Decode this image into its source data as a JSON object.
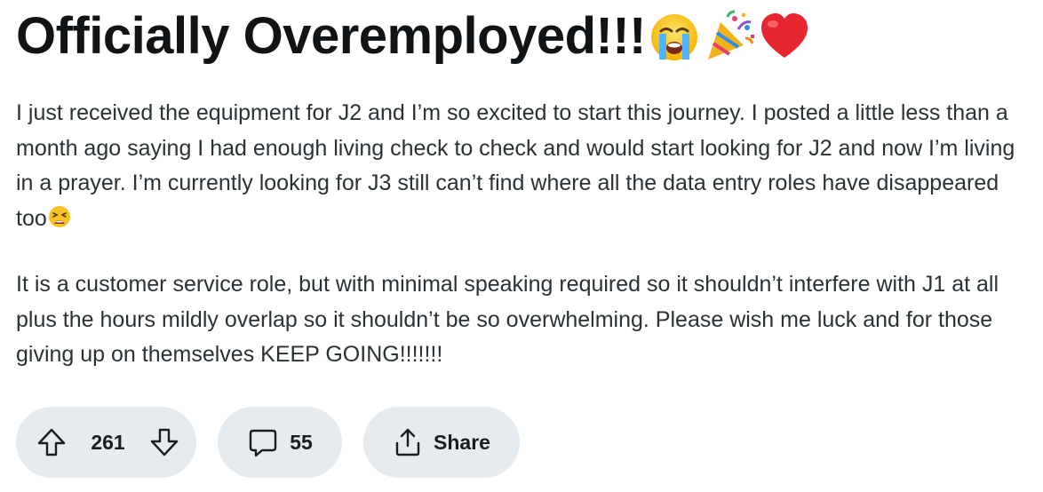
{
  "post": {
    "title": "Officially Overemployed!!!",
    "title_emojis": [
      "loudly-crying-face-icon",
      "party-popper-icon",
      "red-heart-icon"
    ],
    "paragraphs": [
      "I just received the equipment for J2 and I’m so excited to start this journey. I posted a little less than a month ago saying I had enough living check to check and would start looking for J2 and now I’m living in a prayer. I’m currently looking for J3 still can’t find where all the data entry roles have disappeared too",
      "It is a customer service role, but with minimal speaking required so it shouldn’t interfere with J1 at all plus the hours mildly overlap so it shouldn’t be so overwhelming. Please wish me luck and for those giving up on themselves KEEP GOING!!!!!!!"
    ],
    "paragraph1_trailing_emoji": "weary-face-icon"
  },
  "actions": {
    "vote_count": "261",
    "comment_count": "55",
    "share_label": "Share"
  },
  "colors": {
    "pill_background": "#e5ebee",
    "title_text": "#111416",
    "body_text": "#2a3236"
  }
}
